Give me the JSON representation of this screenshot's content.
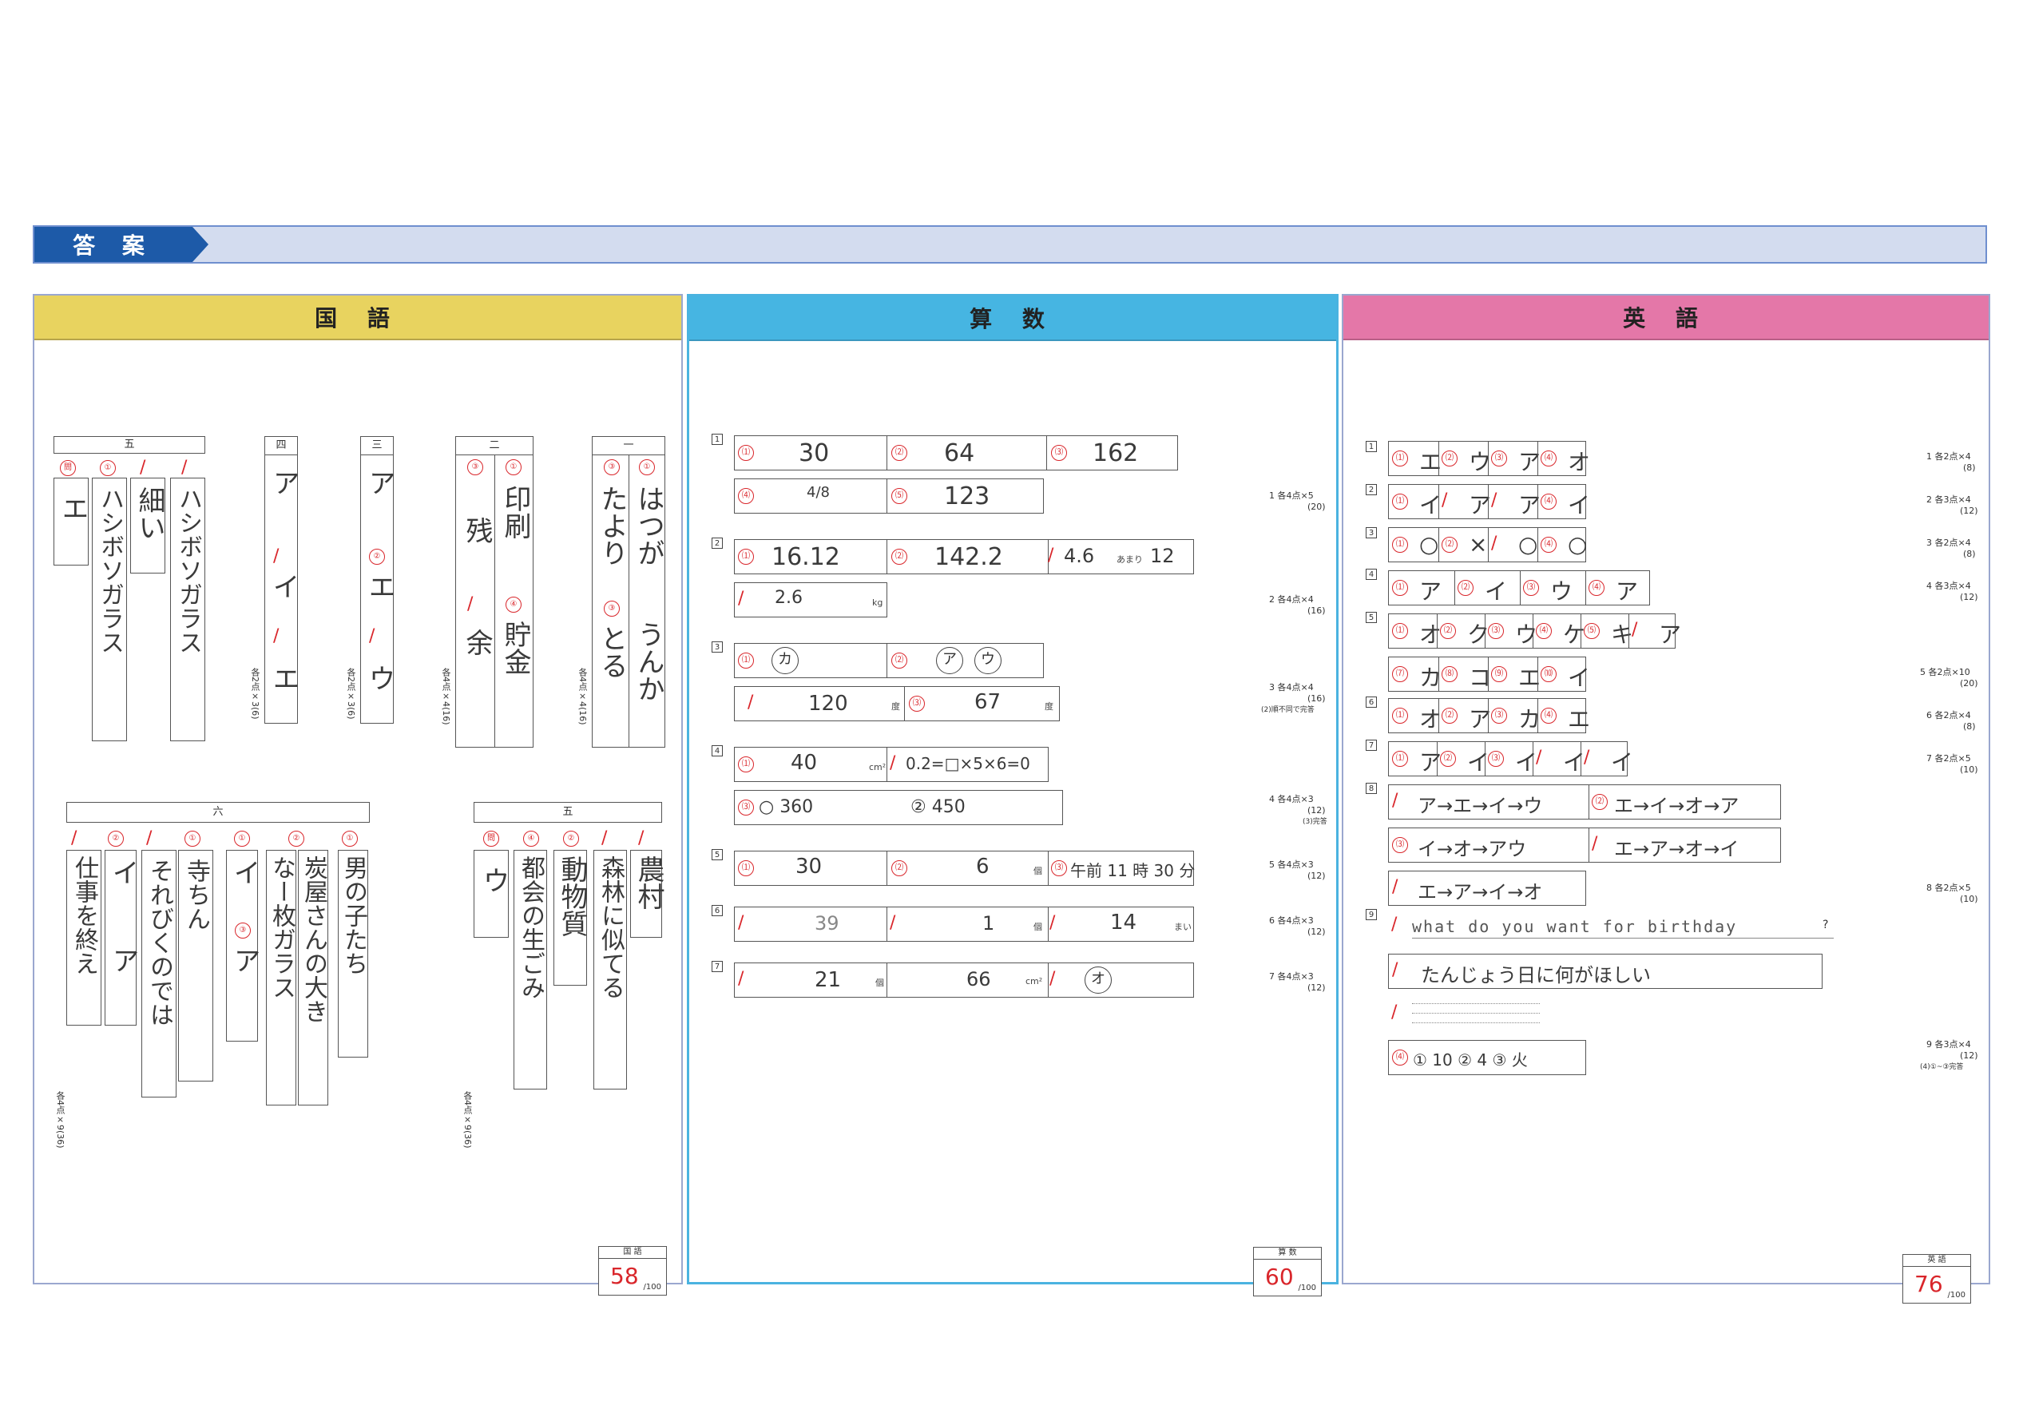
{
  "header": {
    "title": "答 案"
  },
  "panels": {
    "kokugo": {
      "title": "国 語"
    },
    "sansu": {
      "title": "算 数"
    },
    "eigo": {
      "title": "英 語"
    }
  },
  "scores": {
    "kokugo": {
      "label": "国 語",
      "value": "58",
      "denominator": "/100"
    },
    "sansu": {
      "label": "算 数",
      "value": "60",
      "denominator": "/100"
    },
    "eigo": {
      "label": "英 語",
      "value": "76",
      "denominator": "/100"
    }
  },
  "kokugo": {
    "s1": {
      "head": "一",
      "a": "はつが",
      "b": "うんか",
      "c": "たより",
      "d": "とる",
      "pts": "各4点×4(16)"
    },
    "s2": {
      "head": "二",
      "a": "印刷",
      "b": "貯金",
      "c": "残",
      "d": "余",
      "pts": "各4点×4(16)"
    },
    "s3": {
      "head": "三",
      "a": "ア",
      "b": "エ",
      "c": "ウ",
      "pts": "各2点×3(6)"
    },
    "s4": {
      "head": "四",
      "a": "ア",
      "b": "イ",
      "c": "エ",
      "pts": "各2点×3(6)"
    },
    "s5top": {
      "head": "五",
      "a": "エ",
      "b": "ハシボソガラス",
      "c": "細い",
      "d": "ハシボソガラス"
    },
    "s6": {
      "head": "六",
      "a": "男の子たち",
      "b": "炭屋さんの大き",
      "c": "なー枚ガラス",
      "d": "イ",
      "e": "ア",
      "f": "寺ちん",
      "g": "それびくのでは",
      "h": "イ",
      "i": "ア",
      "j": "仕事を終え",
      "pts": "各4点×9(36)"
    },
    "s5bot": {
      "head": "五",
      "a": "農村",
      "b": "森林に似てる",
      "c": "動物質",
      "d": "都会の生ごみ",
      "e": "ウ",
      "pts": "各4点×9(36)"
    }
  },
  "sansu": {
    "q1": {
      "n": "1",
      "a1": "30",
      "a2": "64",
      "a3": "162",
      "a4": "4/8",
      "a5": "123",
      "pts": "1 各4点×5",
      "sub": "(20)"
    },
    "q2": {
      "n": "2",
      "a1": "16.12",
      "a2": "142.2",
      "a3": "4.6",
      "rem_label": "あまり",
      "rem": "12",
      "a4": "2.6",
      "unit": "kg",
      "pts": "2 各4点×4",
      "sub": "(16)"
    },
    "q3": {
      "n": "3",
      "a1": "カ",
      "a2": "ア",
      "a3": "ウ",
      "a4": "120",
      "unit1": "度",
      "a5": "67",
      "unit2": "度",
      "pts": "3 各4点×4",
      "sub": "(16)",
      "note": "(2)順不同で完答"
    },
    "q4": {
      "n": "4",
      "a1": "40",
      "unit1": "cm²",
      "a2": "0.2=□×5×6=0",
      "a3": "○ 360",
      "a4": "② 450",
      "pts": "4 各4点×3",
      "sub": "(12)",
      "note": "(3)完答"
    },
    "q5": {
      "n": "5",
      "a1": "30",
      "a2": "6",
      "unit2": "個",
      "a3": "午前 11 時 30 分",
      "pts": "5 各4点×3",
      "sub": "(12)"
    },
    "q6": {
      "n": "6",
      "a1": "39",
      "a2": "1",
      "unit2": "個",
      "a3": "14",
      "unit3": "まい",
      "pts": "6 各4点×3",
      "sub": "(12)"
    },
    "q7": {
      "n": "7",
      "a1": "21",
      "unit1": "個",
      "a2": "66",
      "unit2": "cm²",
      "a3": "オ",
      "pts": "7 各4点×3",
      "sub": "(12)"
    }
  },
  "eigo": {
    "q1": {
      "n": "1",
      "answers": [
        "エ",
        "ウ",
        "ア",
        "オ"
      ],
      "pts": "1 各2点×4",
      "sub": "(8)"
    },
    "q2": {
      "n": "2",
      "answers": [
        "イ",
        "ア",
        "ア",
        "イ"
      ],
      "pts": "2 各3点×4",
      "sub": "(12)"
    },
    "q3": {
      "n": "3",
      "answers": [
        "○",
        "×",
        "○",
        "○"
      ],
      "pts": "3 各2点×4",
      "sub": "(8)"
    },
    "q4": {
      "n": "4",
      "answers": [
        "ア",
        "イ",
        "ウ",
        "ア"
      ],
      "pts": "4 各3点×4",
      "sub": "(12)"
    },
    "q5": {
      "n": "5",
      "row1": [
        "オ",
        "ク",
        "ウ",
        "ケ",
        "キ",
        "ア"
      ],
      "row2": [
        "カ",
        "コ",
        "エ",
        "イ"
      ],
      "pts": "5 各2点×10",
      "sub": "(20)"
    },
    "q6": {
      "n": "6",
      "answers": [
        "オ",
        "ア",
        "カ",
        "エ"
      ],
      "pts": "6 各2点×4",
      "sub": "(8)"
    },
    "q7": {
      "n": "7",
      "answers": [
        "ア",
        "イ",
        "イ",
        "イ",
        "イ"
      ],
      "pts": "7 各2点×5",
      "sub": "(10)"
    },
    "q8": {
      "n": "8",
      "a1": "ア→エ→イ→ウ",
      "a2": "エ→イ→オ→ア",
      "a3": "イ→オ→アウ",
      "a4": "エ→ア→オ→イ",
      "a5": "エ→ア→イ→オ",
      "pts": "8 各2点×5",
      "sub": "(10)"
    },
    "q9": {
      "n": "9",
      "a1": "what do you want for birthday",
      "qmark": "?",
      "a2": "たんじょう日に何がほしい",
      "a4": "① 10  ② 4  ③ 火",
      "pts": "9 各3点×4",
      "sub": "(12)",
      "note": "(4)①~③完答"
    }
  }
}
